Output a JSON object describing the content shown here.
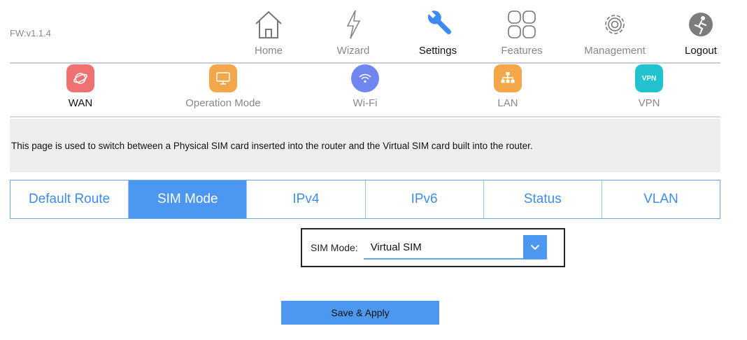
{
  "firmware": "FW:v1.1.4",
  "topnav": {
    "home": "Home",
    "wizard": "Wizard",
    "settings": "Settings",
    "features": "Features",
    "management": "Management",
    "logout": "Logout"
  },
  "subnav": {
    "wan": "WAN",
    "operation_mode": "Operation Mode",
    "wifi": "Wi-Fi",
    "lan": "LAN",
    "vpn": "VPN",
    "vpn_badge": "VPN"
  },
  "info_text": "This page is used to switch between a Physical SIM card inserted into the router and the Virtual SIM card built into the router.",
  "tabs": {
    "default_route": "Default Route",
    "sim_mode": "SIM Mode",
    "ipv4": "IPv4",
    "ipv6": "IPv6",
    "status": "Status",
    "vlan": "VLAN"
  },
  "sim_mode": {
    "label": "SIM Mode:",
    "selected": "Virtual SIM"
  },
  "save_button": "Save & Apply",
  "colors": {
    "accent": "#4c97ef",
    "wan": "#ee7272",
    "operation_mode": "#f3a74a",
    "wifi": "#6f86f0",
    "lan": "#f3a74a",
    "vpn": "#22c3cf"
  }
}
